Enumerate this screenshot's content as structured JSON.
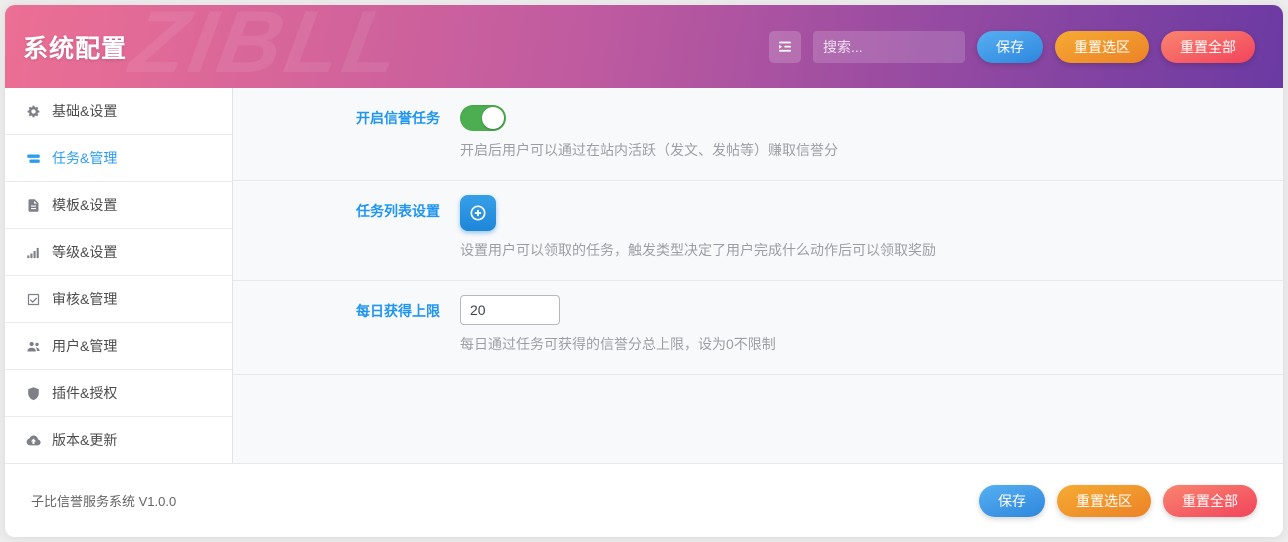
{
  "header": {
    "title": "系统配置",
    "watermark": "ZIBLL",
    "menu_icon": "outdent-icon",
    "search_placeholder": "搜索...",
    "save_label": "保存",
    "reset_selection_label": "重置选区",
    "reset_all_label": "重置全部"
  },
  "sidebar": {
    "items": [
      {
        "label": "基础&设置",
        "icon": "cogs-icon",
        "active": false
      },
      {
        "label": "任务&管理",
        "icon": "tasks-icon",
        "active": true
      },
      {
        "label": "模板&设置",
        "icon": "file-icon",
        "active": false
      },
      {
        "label": "等级&设置",
        "icon": "signal-bars-icon",
        "active": false
      },
      {
        "label": "审核&管理",
        "icon": "check-square-icon",
        "active": false
      },
      {
        "label": "用户&管理",
        "icon": "users-icon",
        "active": false
      },
      {
        "label": "插件&授权",
        "icon": "shield-icon",
        "active": false
      },
      {
        "label": "版本&更新",
        "icon": "cloud-upload-icon",
        "active": false
      }
    ]
  },
  "settings": [
    {
      "label": "开启信誉任务",
      "type": "toggle",
      "value": "on",
      "description": "开启后用户可以通过在站内活跃（发文、发帖等）赚取信誉分"
    },
    {
      "label": "任务列表设置",
      "type": "add-button",
      "icon": "plus-circle-icon",
      "description": "设置用户可以领取的任务，触发类型决定了用户完成什么动作后可以领取奖励"
    },
    {
      "label": "每日获得上限",
      "type": "text-input",
      "value": "20",
      "description": "每日通过任务可获得的信誉分总上限，设为0不限制"
    }
  ],
  "footer": {
    "version": "子比信誉服务系统 V1.0.0",
    "save_label": "保存",
    "reset_selection_label": "重置选区",
    "reset_all_label": "重置全部"
  },
  "colors": {
    "header_gradient_start": "#ec6f94",
    "header_gradient_end": "#6b3aa3",
    "accent_blue": "#2196f0",
    "toggle_green": "#4cae50",
    "button_blue": "#2e86dd",
    "button_orange": "#ec8227",
    "button_red": "#f2435c",
    "content_bg": "#f8f9fa"
  }
}
